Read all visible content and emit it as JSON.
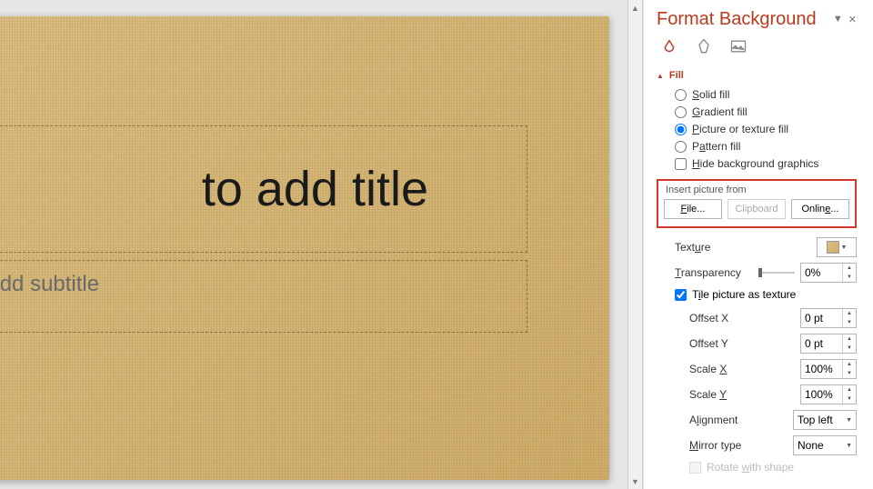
{
  "slide": {
    "title_placeholder": "to add title",
    "subtitle_placeholder": "ck to add subtitle"
  },
  "panel": {
    "title": "Format Background",
    "section_fill": "Fill",
    "fill_options": {
      "solid": "Solid fill",
      "gradient": "Gradient fill",
      "picture_texture": "Picture or texture fill",
      "pattern": "Pattern fill"
    },
    "hide_bg": "Hide background graphics",
    "insert_from": "Insert picture from",
    "buttons": {
      "file": "File...",
      "clipboard": "Clipboard",
      "online": "Online..."
    },
    "texture_label": "Texture",
    "transparency_label": "Transparency",
    "transparency_value": "0%",
    "tile_label": "Tile picture as texture",
    "offset_x": {
      "label": "Offset X",
      "value": "0 pt"
    },
    "offset_y": {
      "label": "Offset Y",
      "value": "0 pt"
    },
    "scale_x": {
      "label": "Scale X",
      "value": "100%"
    },
    "scale_y": {
      "label": "Scale Y",
      "value": "100%"
    },
    "alignment": {
      "label": "Alignment",
      "value": "Top left"
    },
    "mirror": {
      "label": "Mirror type",
      "value": "None"
    },
    "rotate": "Rotate with shape"
  }
}
